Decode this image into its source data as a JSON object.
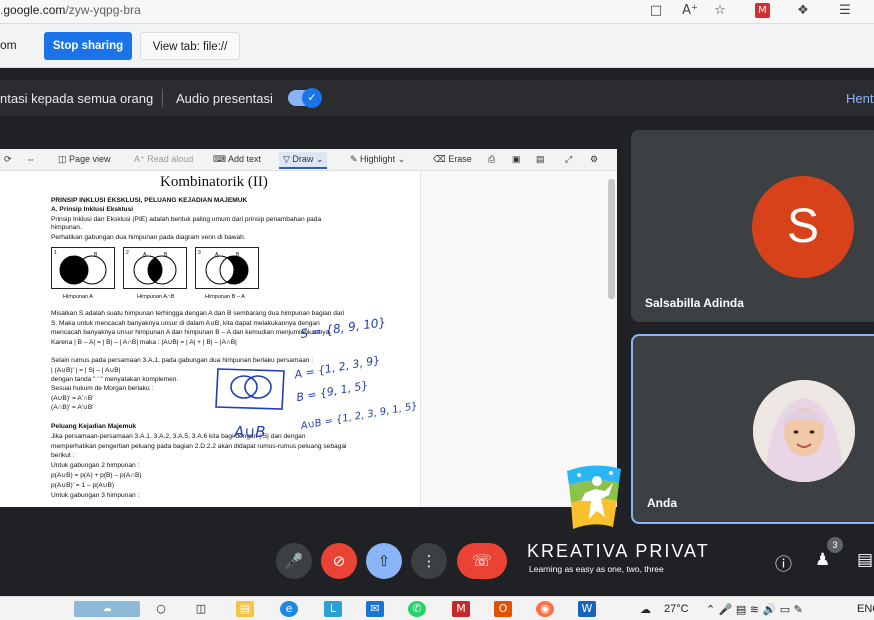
{
  "browser": {
    "url_host": "google.com",
    "url_path": "/zyw-yqpg-bra",
    "url_prefix": "."
  },
  "sharing_bar": {
    "left_text": "om",
    "stop_label": "Stop sharing",
    "view_label": "View tab: file://"
  },
  "presenter_bar": {
    "presenting_text": "ntasi kepada semua orang",
    "audio_label": "Audio presentasi",
    "audio_on": true,
    "stop_text": "Hent"
  },
  "doc_toolbar": {
    "page_view": "Page view",
    "read_aloud": "Read aloud",
    "add_text": "Add text",
    "draw": "Draw",
    "highlight": "Highlight",
    "erase": "Erase"
  },
  "document": {
    "title": "Kombinatorik (II)",
    "heading": "PRINSIP INKLUSI EKSKLUSI, PELUANG KEJADIAN MAJEMUK",
    "subheading": "A. Prinsip Inklusi Eksklusi",
    "lines1": [
      "Prinsip Inklusi dan Eksklusi (PIE) adalah bentuk paling umum dari prinsip penambahan pada",
      "himpunan.",
      "Perhatikan gabungan dua himpunan pada diagram venn di bawah."
    ],
    "venn": [
      {
        "num": "1",
        "caption": "Himpunan A"
      },
      {
        "num": "2",
        "caption": "Himpunan A∩B"
      },
      {
        "num": "3",
        "caption": "Himpunan B – A"
      }
    ],
    "venn_labels": {
      "a": "A",
      "b": "B"
    },
    "lines2": [
      "Misalkan S adalah suatu himpunan terhingga dengan A dan B sembarang dua himpunan bagian dari",
      "S. Maka untuk mencacah banyaknya unsur di dalam A∪B, kita dapat melakukannya dengan",
      "mencacah banyaknya unsur himpunan A dan himpunan B – A dan kemudian menjumlahkannya.",
      "Karena | B – A| = | B| – | A∩B| maka : |A∪B| = | A| + | B| – |A∩B|"
    ],
    "lines3": [
      "Selain rumus pada persamaan 3.A.1, pada gabungan dua himpunan berlaku persamaan :",
      "| (A∪B)' | = | S| – | A∪B|",
      "dengan tanda \" ' \" menyatakan komplemen.",
      "Sesuai hukum de Morgan berlaku :",
      "(A∪B)' = A'∩B'",
      "(A∩B)' = A'∪B'"
    ],
    "subheading2": "Peluang Kejadian Majemuk",
    "lines4": [
      "Jika persamaan-persamaan 3.A.1, 3.A.2, 3.A.5, 3.A.6 kita bagi dengan | S| dan dengan",
      "memperhatikan pengertian peluang pada bagian 2.D.2.2 akan didapat rumus-rumus peluang sebagai",
      "berikut :",
      "Untuk gabungan 2 himpunan :",
      "p(A∪B) = p(A) + p(B) – p(A∩B)",
      "p(A∪B)' = 1 – p(A∪B)",
      "Untuk gabungan 3 himpunan :"
    ],
    "handwriting": {
      "s_set": "S = {8, 9, 10}",
      "a_set": "A = {1, 2, 3, 9}",
      "b_set": "B = {9, 1, 5}",
      "union_label": "A∪B",
      "aub_set": "A∪B = {1, 2, 3, 9, 1, 5}"
    }
  },
  "participants": [
    {
      "name": "Salsabilla Adinda",
      "initial": "S",
      "avatar_color": "#d7421b"
    },
    {
      "name": "Anda"
    }
  ],
  "controls": {
    "mic_icon": "mic-icon",
    "camera_off_icon": "camera-off-icon",
    "present_icon": "present-icon",
    "more_icon": "more-vert-icon",
    "end_call_icon": "end-call-icon",
    "people_count": "3"
  },
  "watermark": {
    "title": "KREATIVA PRIVAT",
    "tagline": "Learning as easy as one, two, three"
  },
  "taskbar": {
    "temperature": "27°C",
    "language": "ENG"
  },
  "colors": {
    "meet_bg": "#202124",
    "accent_blue": "#1a73e8",
    "end_red": "#ea4335",
    "ink_blue": "#1f3fb4"
  }
}
